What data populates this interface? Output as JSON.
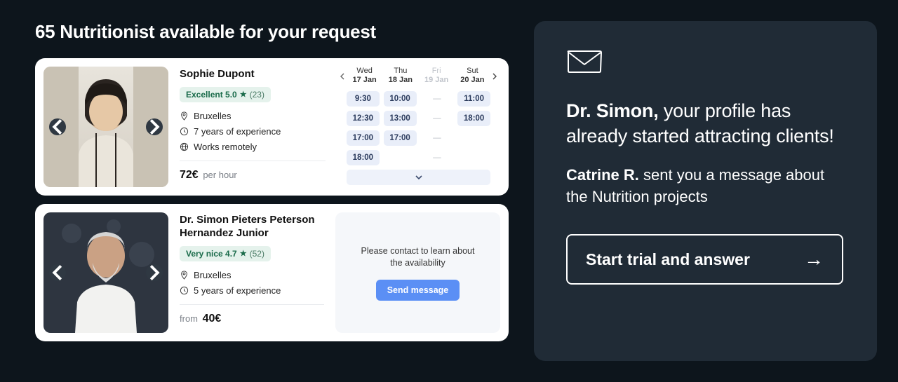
{
  "heading": "65 Nutritionist available for your request",
  "card1": {
    "name": "Sophie Dupont",
    "badge_text": "Excellent 5.0",
    "badge_count": "(23)",
    "location": "Bruxelles",
    "experience": "7 years of experience",
    "remote": "Works remotely",
    "price": "72€",
    "price_suffix": "per hour",
    "days": [
      {
        "dow": "Wed",
        "dom": "17 Jan",
        "disabled": false
      },
      {
        "dow": "Thu",
        "dom": "18 Jan",
        "disabled": false
      },
      {
        "dow": "Fri",
        "dom": "19 Jan",
        "disabled": true
      },
      {
        "dow": "Sut",
        "dom": "20 Jan",
        "disabled": false
      }
    ],
    "slots": [
      [
        "9:30",
        "10:00",
        "—",
        "11:00"
      ],
      [
        "12:30",
        "13:00",
        "—",
        "18:00"
      ],
      [
        "17:00",
        "17:00",
        "—",
        ""
      ],
      [
        "18:00",
        "",
        "—",
        ""
      ]
    ]
  },
  "card2": {
    "name": "Dr. Simon Pieters Peterson Hernandez Junior",
    "badge_text": "Very nice 4.7",
    "badge_count": "(52)",
    "location": "Bruxelles",
    "experience": "5 years of experience",
    "price_prefix": "from",
    "price": "40€",
    "contact_msg": "Please contact to learn about the availability",
    "send_label": "Send message"
  },
  "promo": {
    "name": "Dr. Simon,",
    "headline_rest": " your profile has already started attracting clients!",
    "sender": "Catrine R.",
    "sub_rest": " sent you a message about the Nutrition projects",
    "cta": "Start trial and answer"
  }
}
